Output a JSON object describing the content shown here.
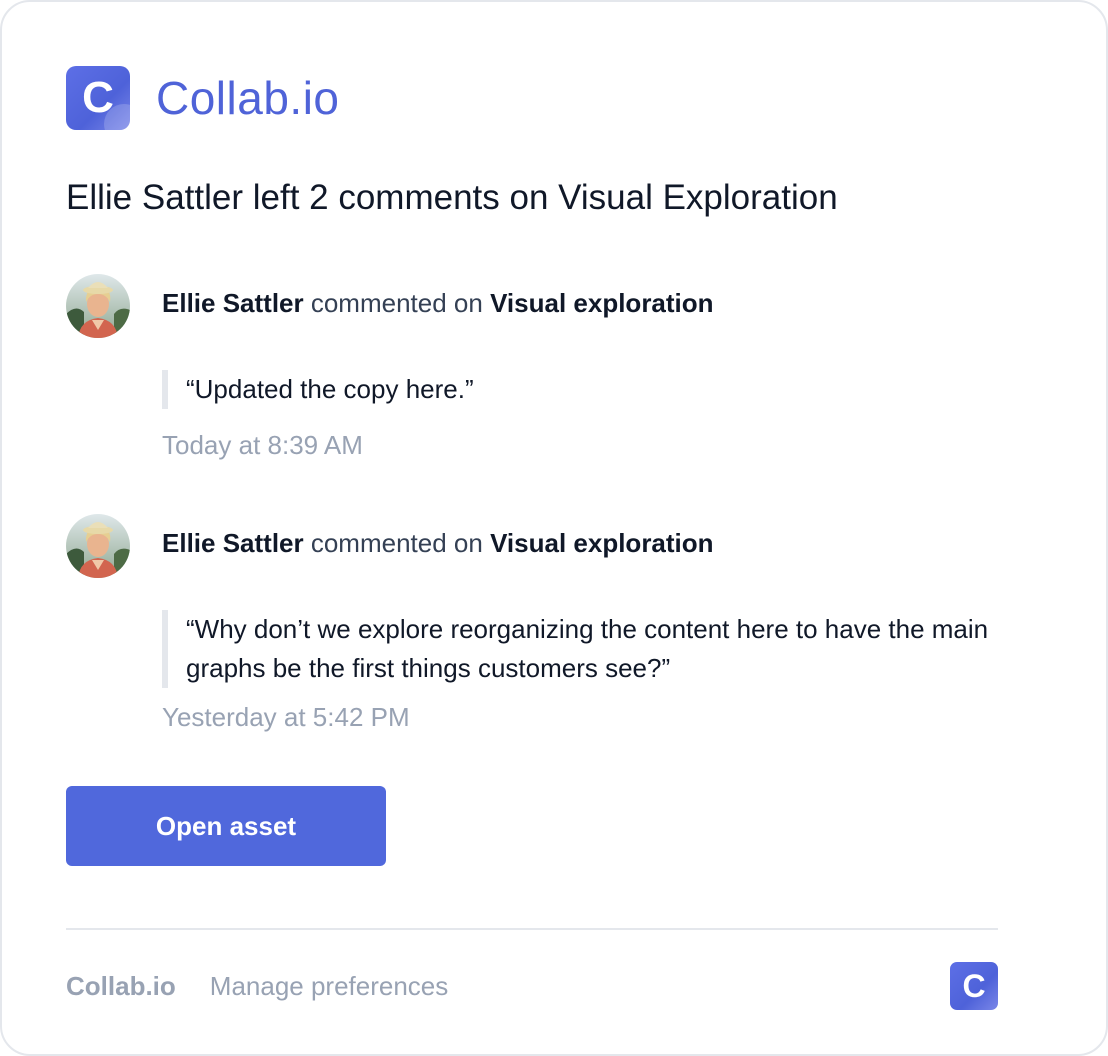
{
  "brand": {
    "logo_letter": "C",
    "name": "Collab.io",
    "color": "#4f63d8"
  },
  "headline": "Ellie Sattler left 2 comments on Visual Exploration",
  "comments": [
    {
      "author": "Ellie Sattler",
      "action": " commented on ",
      "target": "Visual exploration",
      "quote": "“Updated the copy here.”",
      "timestamp": "Today at 8:39 AM"
    },
    {
      "author": "Ellie Sattler",
      "action": " commented on ",
      "target": "Visual exploration",
      "quote": "“Why don’t we explore reorganizing the content here to have the main graphs be the first things customers see?”",
      "timestamp": "Yesterday at 5:42 PM"
    }
  ],
  "cta": {
    "label": "Open asset",
    "color": "#5068dc"
  },
  "footer": {
    "brand": "Collab.io",
    "manage_link": "Manage preferences",
    "logo_letter": "C"
  }
}
